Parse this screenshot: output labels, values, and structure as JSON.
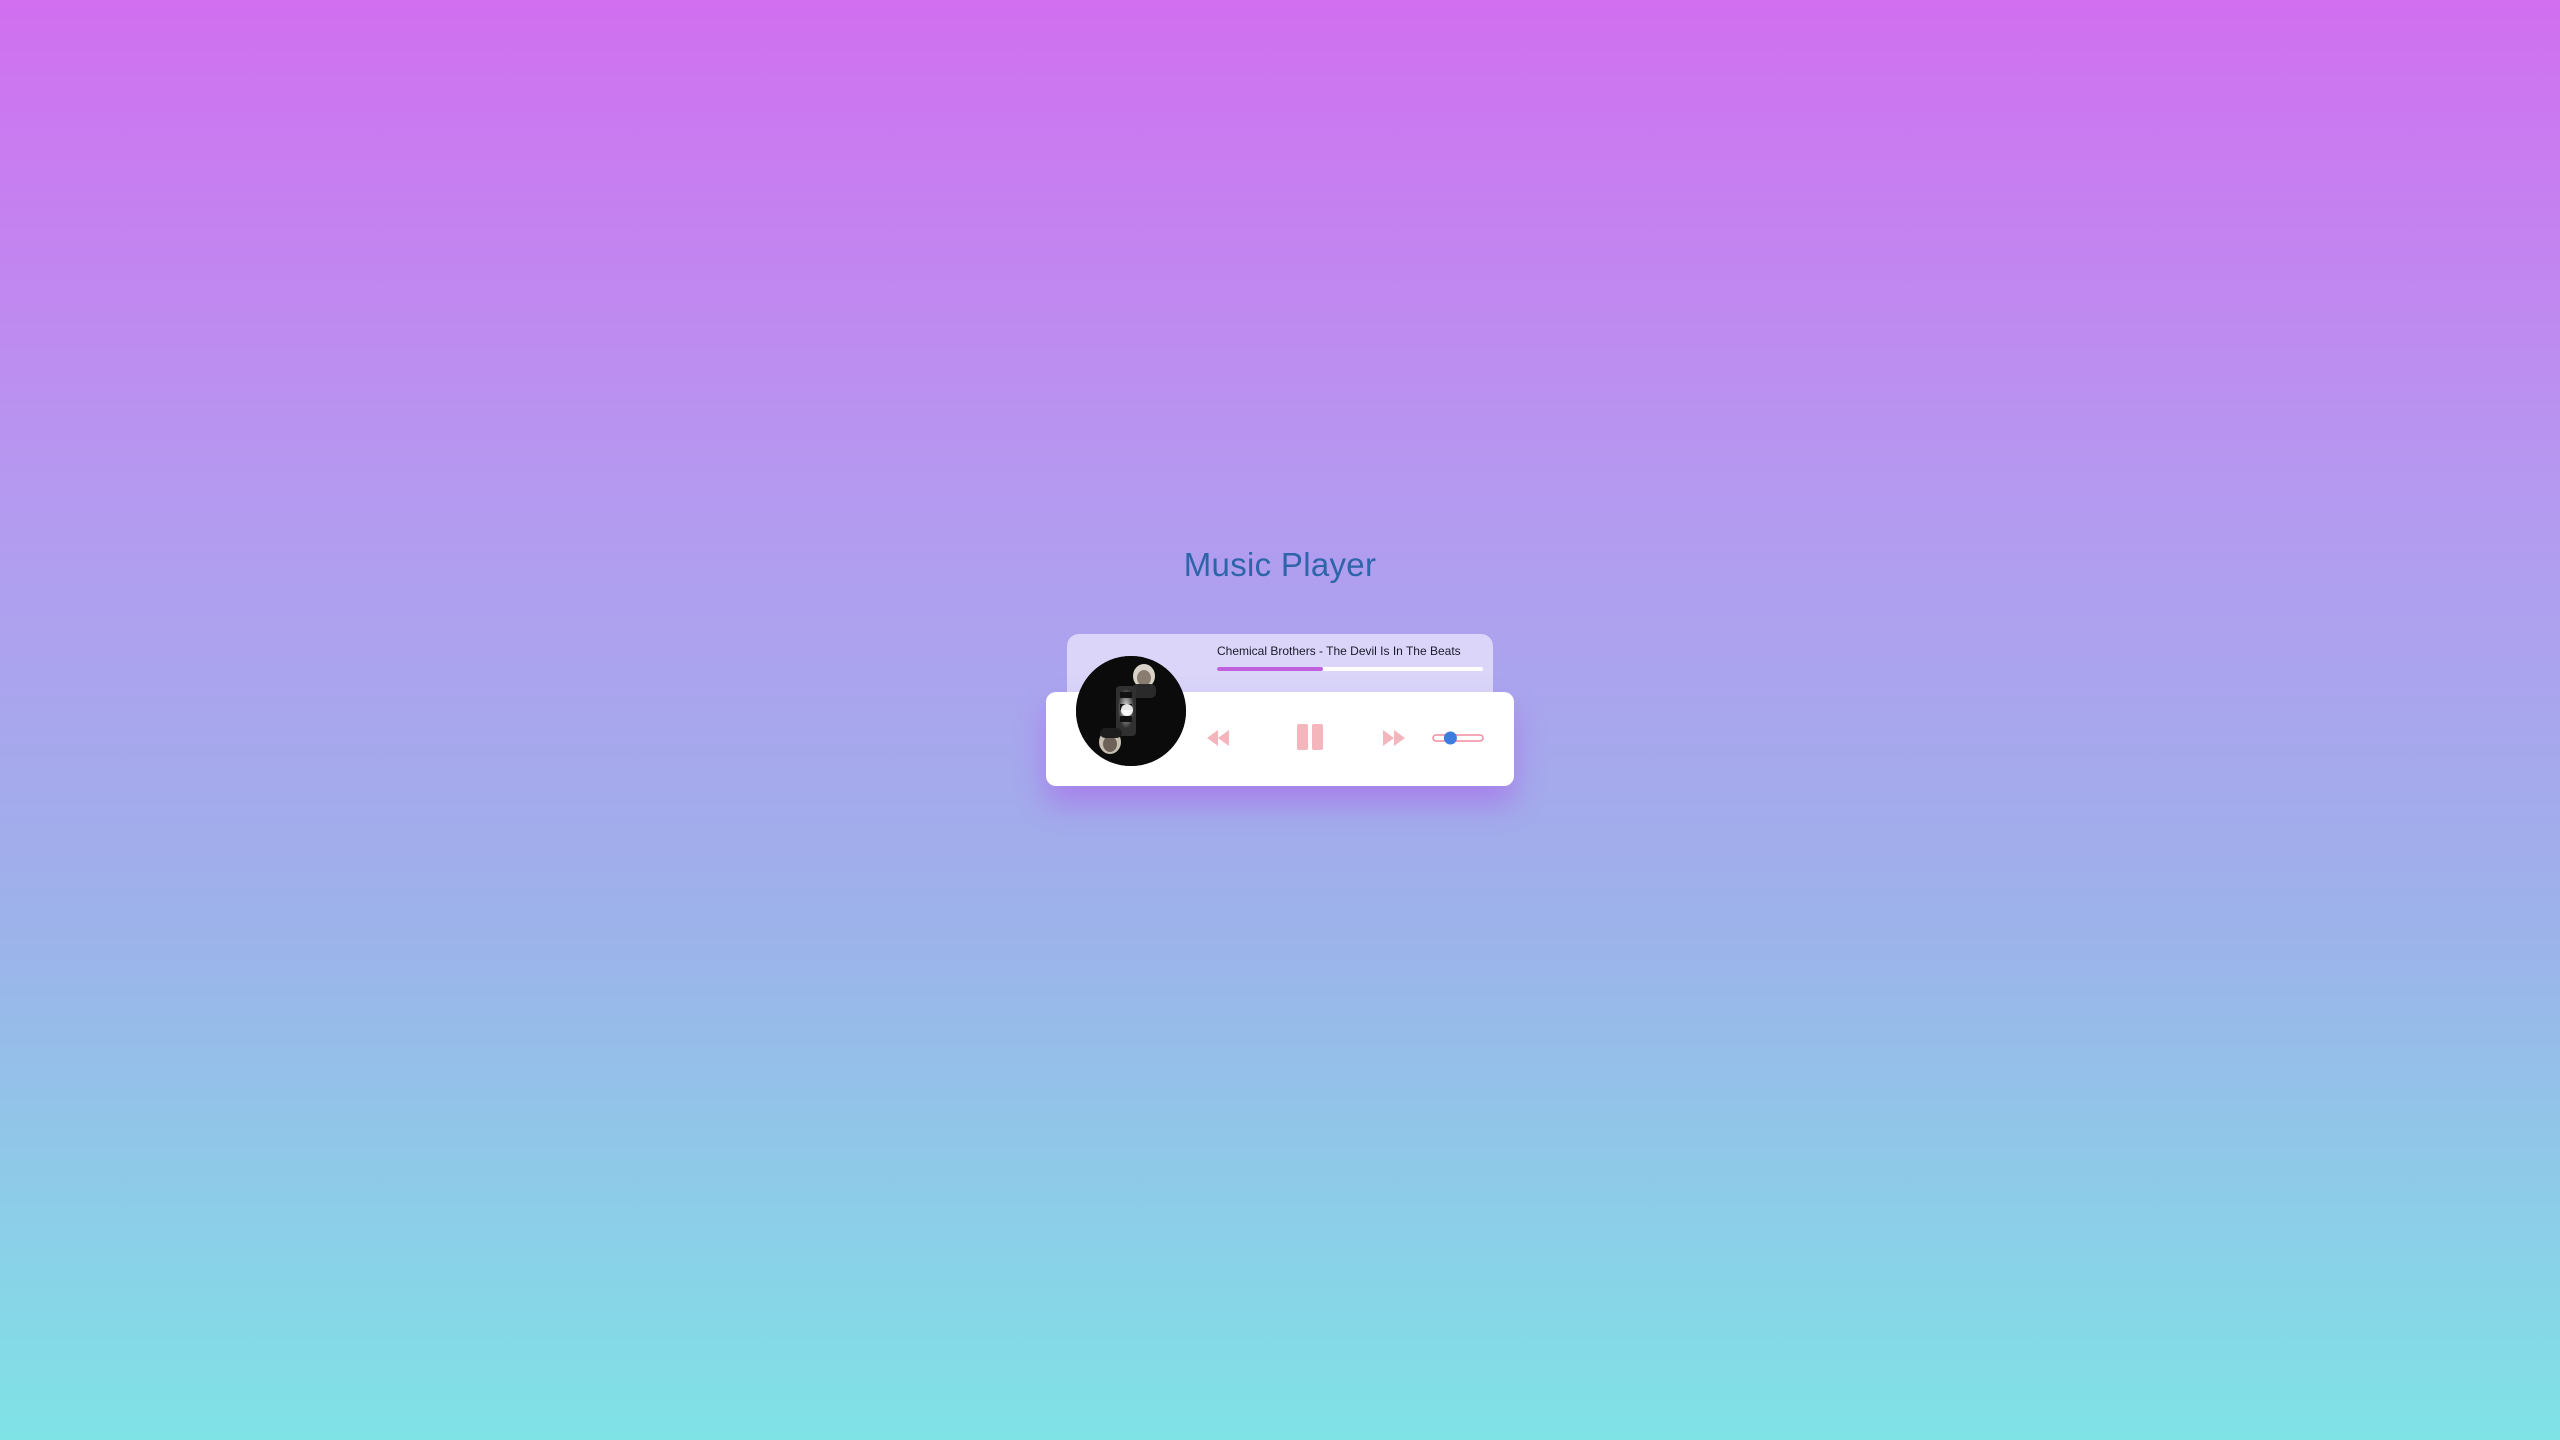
{
  "header": {
    "title": "Music Player"
  },
  "player": {
    "track_title": "Chemical Brothers - The Devil Is In The Beats",
    "progress": 0.4,
    "volume": 0.3,
    "album_art_label": "album-art",
    "controls": {
      "rewind_icon": "rewind-icon",
      "pause_icon": "pause-icon",
      "forward_icon": "fast-forward-icon"
    }
  },
  "colors": {
    "accent": "#c060dc",
    "title": "#2e64a8",
    "control": "#f4b6bc",
    "volume_thumb": "#3d7de0"
  }
}
